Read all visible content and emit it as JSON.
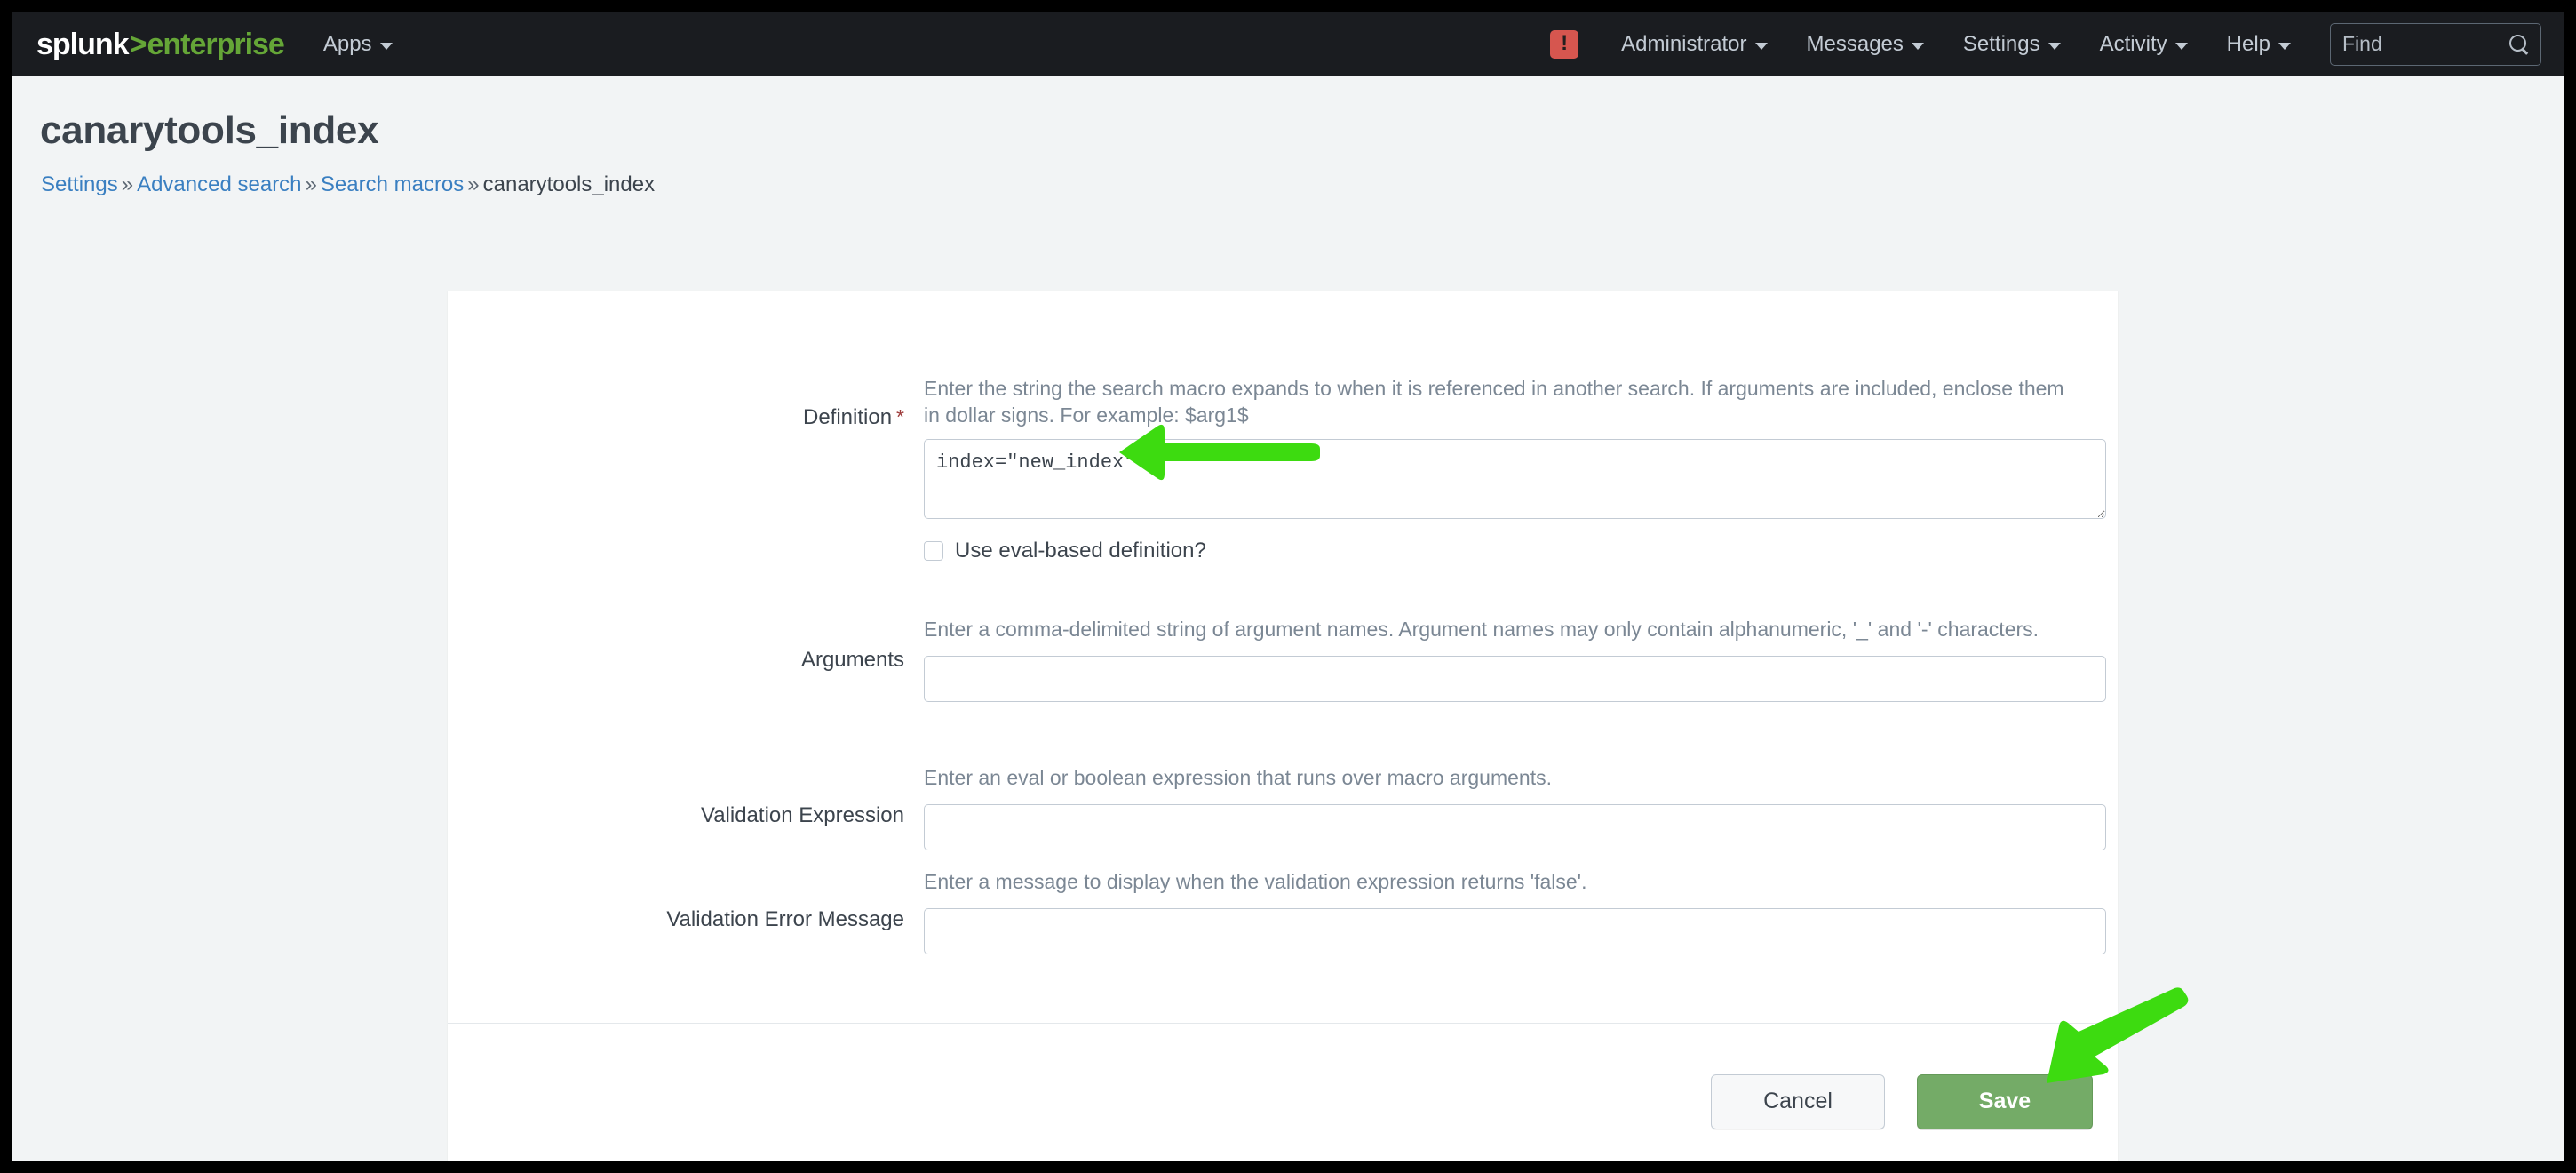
{
  "topbar": {
    "logo_brand": "splunk",
    "logo_chevron": ">",
    "logo_product": "enterprise",
    "apps_label": "Apps",
    "warning_icon_label": "!",
    "administrator_label": "Administrator",
    "messages_label": "Messages",
    "settings_label": "Settings",
    "activity_label": "Activity",
    "help_label": "Help",
    "find_placeholder": "Find",
    "find_value": "",
    "background_color": "#1a1c20",
    "accent_color": "#65a637",
    "warning_color": "#d6564f"
  },
  "page": {
    "title": "canarytools_index",
    "breadcrumb": {
      "item1": "Settings",
      "item2": "Advanced search",
      "item3": "Search macros",
      "current": "canarytools_index",
      "separator": "»"
    }
  },
  "form": {
    "definition": {
      "label": "Definition",
      "required_marker": "*",
      "help": "Enter the string the search macro expands to when it is referenced in another search. If arguments are included, enclose them in dollar signs. For example: $arg1$",
      "value": "index=\"new_index\"",
      "eval_checkbox_label": "Use eval-based definition?",
      "eval_checkbox_checked": false
    },
    "arguments": {
      "label": "Arguments",
      "help": "Enter a comma-delimited string of argument names. Argument names may only contain alphanumeric, '_' and '-' characters.",
      "value": "",
      "placeholder": ""
    },
    "validation_expression": {
      "label": "Validation Expression",
      "help": "Enter an eval or boolean expression that runs over macro arguments.",
      "value": "",
      "placeholder": ""
    },
    "validation_error_message": {
      "label": "Validation Error Message",
      "help": "Enter a message to display when the validation expression returns 'false'.",
      "value": "",
      "placeholder": ""
    }
  },
  "footer": {
    "cancel_label": "Cancel",
    "save_label": "Save",
    "save_color": "#74ab67"
  },
  "annotations": {
    "arrow_color": "#3ddb10",
    "arrow_definition_target": "definition-textarea",
    "arrow_save_target": "save-button"
  }
}
